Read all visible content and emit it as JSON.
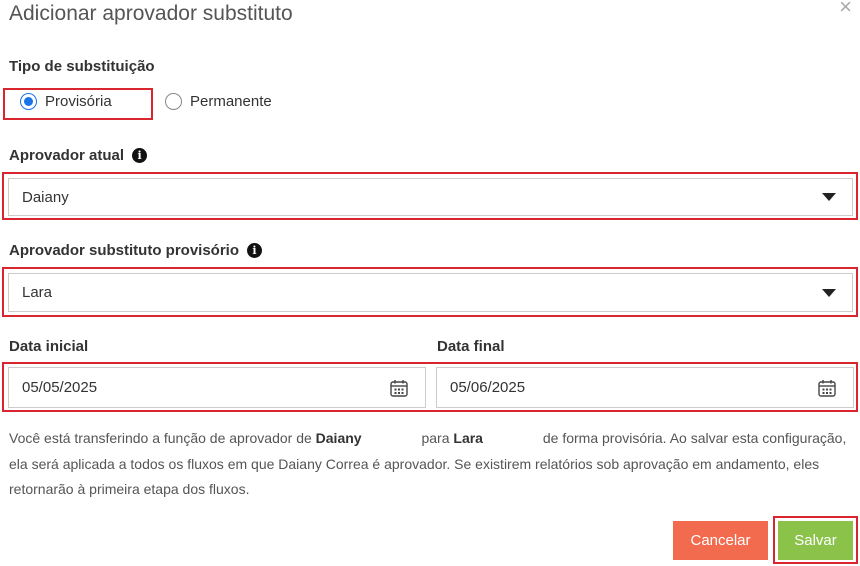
{
  "dialog": {
    "title": "Adicionar aprovador substituto",
    "close_symbol": "×"
  },
  "substitution_type": {
    "label": "Tipo de substituição",
    "options": [
      {
        "label": "Provisória",
        "selected": true
      },
      {
        "label": "Permanente",
        "selected": false
      }
    ]
  },
  "current_approver": {
    "label": "Aprovador atual",
    "value": "Daiany"
  },
  "substitute_approver": {
    "label": "Aprovador substituto provisório",
    "value": "Lara"
  },
  "start_date": {
    "label": "Data inicial",
    "value": "05/05/2025"
  },
  "end_date": {
    "label": "Data final",
    "value": "05/06/2025"
  },
  "note": {
    "part1": "Você está transferindo a função de aprovador de",
    "from_name": "Daiany",
    "part2": "para",
    "to_name": "Lara",
    "part3": "de forma provisória. Ao salvar esta configuração, ela será aplicada a todos os fluxos em que Daiany Correa é aprovador. Se existirem relatórios sob aprovação em andamento, eles retornarão à primeira etapa dos fluxos."
  },
  "buttons": {
    "cancel": "Cancelar",
    "save": "Salvar"
  },
  "colors": {
    "highlight": "#d9262e",
    "radio_selected": "#1a73e8",
    "cancel_bg": "#f26b4f",
    "save_bg": "#8bc34a"
  }
}
